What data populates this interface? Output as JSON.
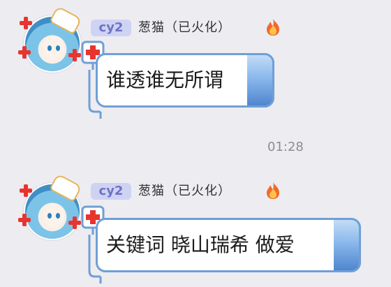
{
  "messages": [
    {
      "badge": "cy2",
      "sender": "葱猫（已火化）",
      "text": "谁透谁无所谓"
    },
    {
      "badge": "cy2",
      "sender": "葱猫（已火化）",
      "text": "关键词 晓山瑞希 做爱"
    }
  ],
  "timestamp": "01:28",
  "colors": {
    "background": "#edecf1",
    "badge_bg": "#cfd3f3",
    "badge_text": "#6d73c7",
    "bubble_border": "#6f9fd6"
  }
}
